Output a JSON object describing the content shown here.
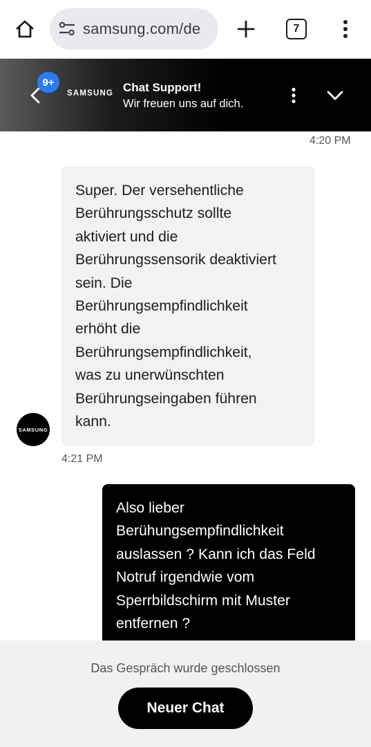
{
  "browser": {
    "url": "samsung.com/de",
    "tab_count": "7",
    "icons": [
      "home-icon",
      "site-settings-icon",
      "plus-icon",
      "tab-switcher-icon",
      "more-vert-icon"
    ]
  },
  "header": {
    "badge": "9+",
    "brand": "SAMSUNG",
    "title": "Chat Support!",
    "subtitle": "Wir freuen uns auf dich."
  },
  "messages": [
    {
      "sender": "agent",
      "time_above": "4:20 PM",
      "lines": [
        "Super. Der versehentliche",
        "Berührungsschutz sollte",
        "aktiviert und die",
        "Berührungssensorik deaktiviert",
        "sein. Die",
        "Berührungsempfindlichkeit",
        "erhöht die",
        "Berührungsempfindlichkeit,",
        "was zu unerwünschten",
        "Berührungseingaben führen",
        "kann."
      ],
      "time": "4:21 PM",
      "avatar": "SAMSUNG"
    },
    {
      "sender": "user",
      "lines": [
        "Also lieber",
        "Berühungsempfindlichkeit",
        "auslassen ? Kann ich das Feld",
        "Notruf irgendwie vom",
        "Sperrbildschirm mit Muster",
        "entfernen ?"
      ]
    }
  ],
  "footer": {
    "closed_text": "Das Gespräch wurde geschlossen",
    "new_chat_label": "Neuer Chat"
  },
  "colors": {
    "badge": "#2a7bf4",
    "agent_bubble": "#f1f2f4",
    "user_bubble": "#000000",
    "footer_bg": "#f1f1f3"
  }
}
